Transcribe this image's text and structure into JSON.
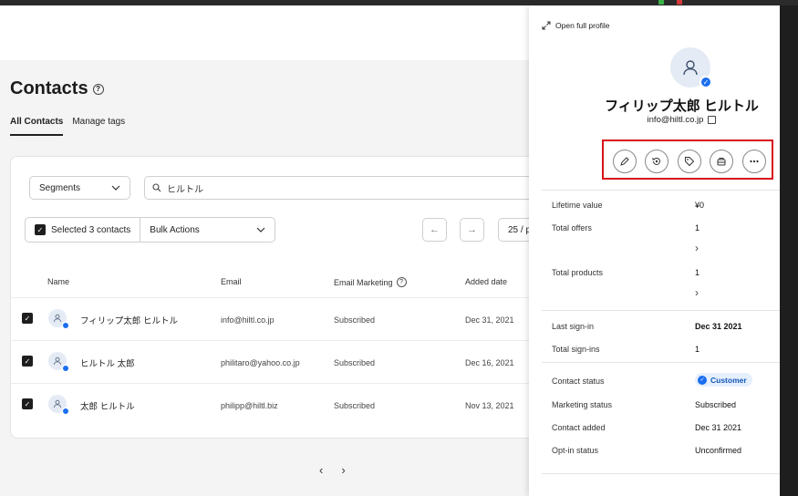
{
  "colors": {
    "accent": "#1a6ef0",
    "highlight": "#d6121c",
    "panel_bg": "#ffffff",
    "page_bg": "#f4f4f4"
  },
  "page": {
    "title": "Contacts",
    "tabs": [
      {
        "label": "All Contacts",
        "active": true
      },
      {
        "label": "Manage tags",
        "active": false
      }
    ]
  },
  "filters": {
    "segments_label": "Segments",
    "search_value": "ヒルトル",
    "selected_label": "Selected 3 contacts",
    "bulk_label": "Bulk Actions",
    "per_page": "25 / p"
  },
  "table": {
    "headers": {
      "name": "Name",
      "email": "Email",
      "marketing": "Email Marketing",
      "added": "Added date"
    },
    "rows": [
      {
        "name": "フィリップ太郎 ヒルトル",
        "email": "info@hiltl.co.jp",
        "marketing": "Subscribed",
        "added": "Dec 31, 2021"
      },
      {
        "name": "ヒルトル 太郎",
        "email": "philitaro@yahoo.co.jp",
        "marketing": "Subscribed",
        "added": "Dec 16, 2021"
      },
      {
        "name": "太郎 ヒルトル",
        "email": "philipp@hiltl.biz",
        "marketing": "Subscribed",
        "added": "Nov 13, 2021"
      }
    ]
  },
  "panel": {
    "open_full": "Open full profile",
    "name": "フィリップ太郎 ヒルトル",
    "email": "info@hiltl.co.jp",
    "actions": [
      "edit-icon",
      "history-icon",
      "tag-icon",
      "handshake-icon",
      "more-icon"
    ],
    "fields": {
      "lifetime_label": "Lifetime value",
      "lifetime_value": "¥0",
      "offers_label": "Total offers",
      "offers_value": "1",
      "products_label": "Total products",
      "products_value": "1",
      "last_signin_label": "Last sign-in",
      "last_signin_value": "Dec 31 2021",
      "signins_label": "Total sign-ins",
      "signins_value": "1",
      "contact_status_label": "Contact status",
      "contact_status_value": "Customer",
      "marketing_status_label": "Marketing status",
      "marketing_status_value": "Subscribed",
      "contact_added_label": "Contact added",
      "contact_added_value": "Dec 31 2021",
      "optin_label": "Opt-in status",
      "optin_value": "Unconfirmed"
    }
  }
}
